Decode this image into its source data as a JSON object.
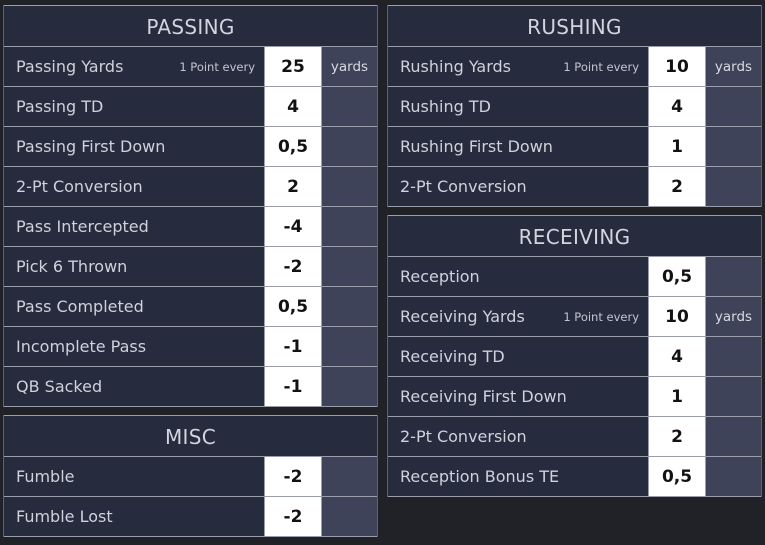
{
  "theme": {
    "page_bg": "#212128",
    "card_bg": "#2a3048",
    "label_bg": "#262b3e",
    "unit_bg": "#3e4359",
    "value_bg": "#ffffff",
    "value_text": "#121212",
    "label_text": "#cfd2db",
    "border": "#9a9eab"
  },
  "columns": [
    {
      "name": "left-column",
      "sections": [
        {
          "title": "PASSING",
          "rows": [
            {
              "label": "Passing Yards",
              "hint": "1 Point every",
              "value": "25",
              "unit": "yards"
            },
            {
              "label": "Passing TD",
              "hint": "",
              "value": "4",
              "unit": ""
            },
            {
              "label": "Passing First Down",
              "hint": "",
              "value": "0,5",
              "unit": ""
            },
            {
              "label": "2-Pt Conversion",
              "hint": "",
              "value": "2",
              "unit": ""
            },
            {
              "label": "Pass Intercepted",
              "hint": "",
              "value": "-4",
              "unit": ""
            },
            {
              "label": "Pick 6 Thrown",
              "hint": "",
              "value": "-2",
              "unit": ""
            },
            {
              "label": "Pass Completed",
              "hint": "",
              "value": "0,5",
              "unit": ""
            },
            {
              "label": "Incomplete Pass",
              "hint": "",
              "value": "-1",
              "unit": ""
            },
            {
              "label": "QB Sacked",
              "hint": "",
              "value": "-1",
              "unit": ""
            }
          ]
        },
        {
          "title": "MISC",
          "rows": [
            {
              "label": "Fumble",
              "hint": "",
              "value": "-2",
              "unit": ""
            },
            {
              "label": "Fumble Lost",
              "hint": "",
              "value": "-2",
              "unit": ""
            }
          ]
        }
      ]
    },
    {
      "name": "right-column",
      "sections": [
        {
          "title": "RUSHING",
          "rows": [
            {
              "label": "Rushing Yards",
              "hint": "1 Point every",
              "value": "10",
              "unit": "yards"
            },
            {
              "label": "Rushing TD",
              "hint": "",
              "value": "4",
              "unit": ""
            },
            {
              "label": "Rushing First Down",
              "hint": "",
              "value": "1",
              "unit": ""
            },
            {
              "label": "2-Pt Conversion",
              "hint": "",
              "value": "2",
              "unit": ""
            }
          ]
        },
        {
          "title": "RECEIVING",
          "rows": [
            {
              "label": "Reception",
              "hint": "",
              "value": "0,5",
              "unit": ""
            },
            {
              "label": "Receiving Yards",
              "hint": "1 Point every",
              "value": "10",
              "unit": "yards"
            },
            {
              "label": "Receiving TD",
              "hint": "",
              "value": "4",
              "unit": ""
            },
            {
              "label": "Receiving First Down",
              "hint": "",
              "value": "1",
              "unit": ""
            },
            {
              "label": "2-Pt Conversion",
              "hint": "",
              "value": "2",
              "unit": ""
            },
            {
              "label": "Reception Bonus TE",
              "hint": "",
              "value": "0,5",
              "unit": ""
            }
          ]
        }
      ]
    }
  ]
}
